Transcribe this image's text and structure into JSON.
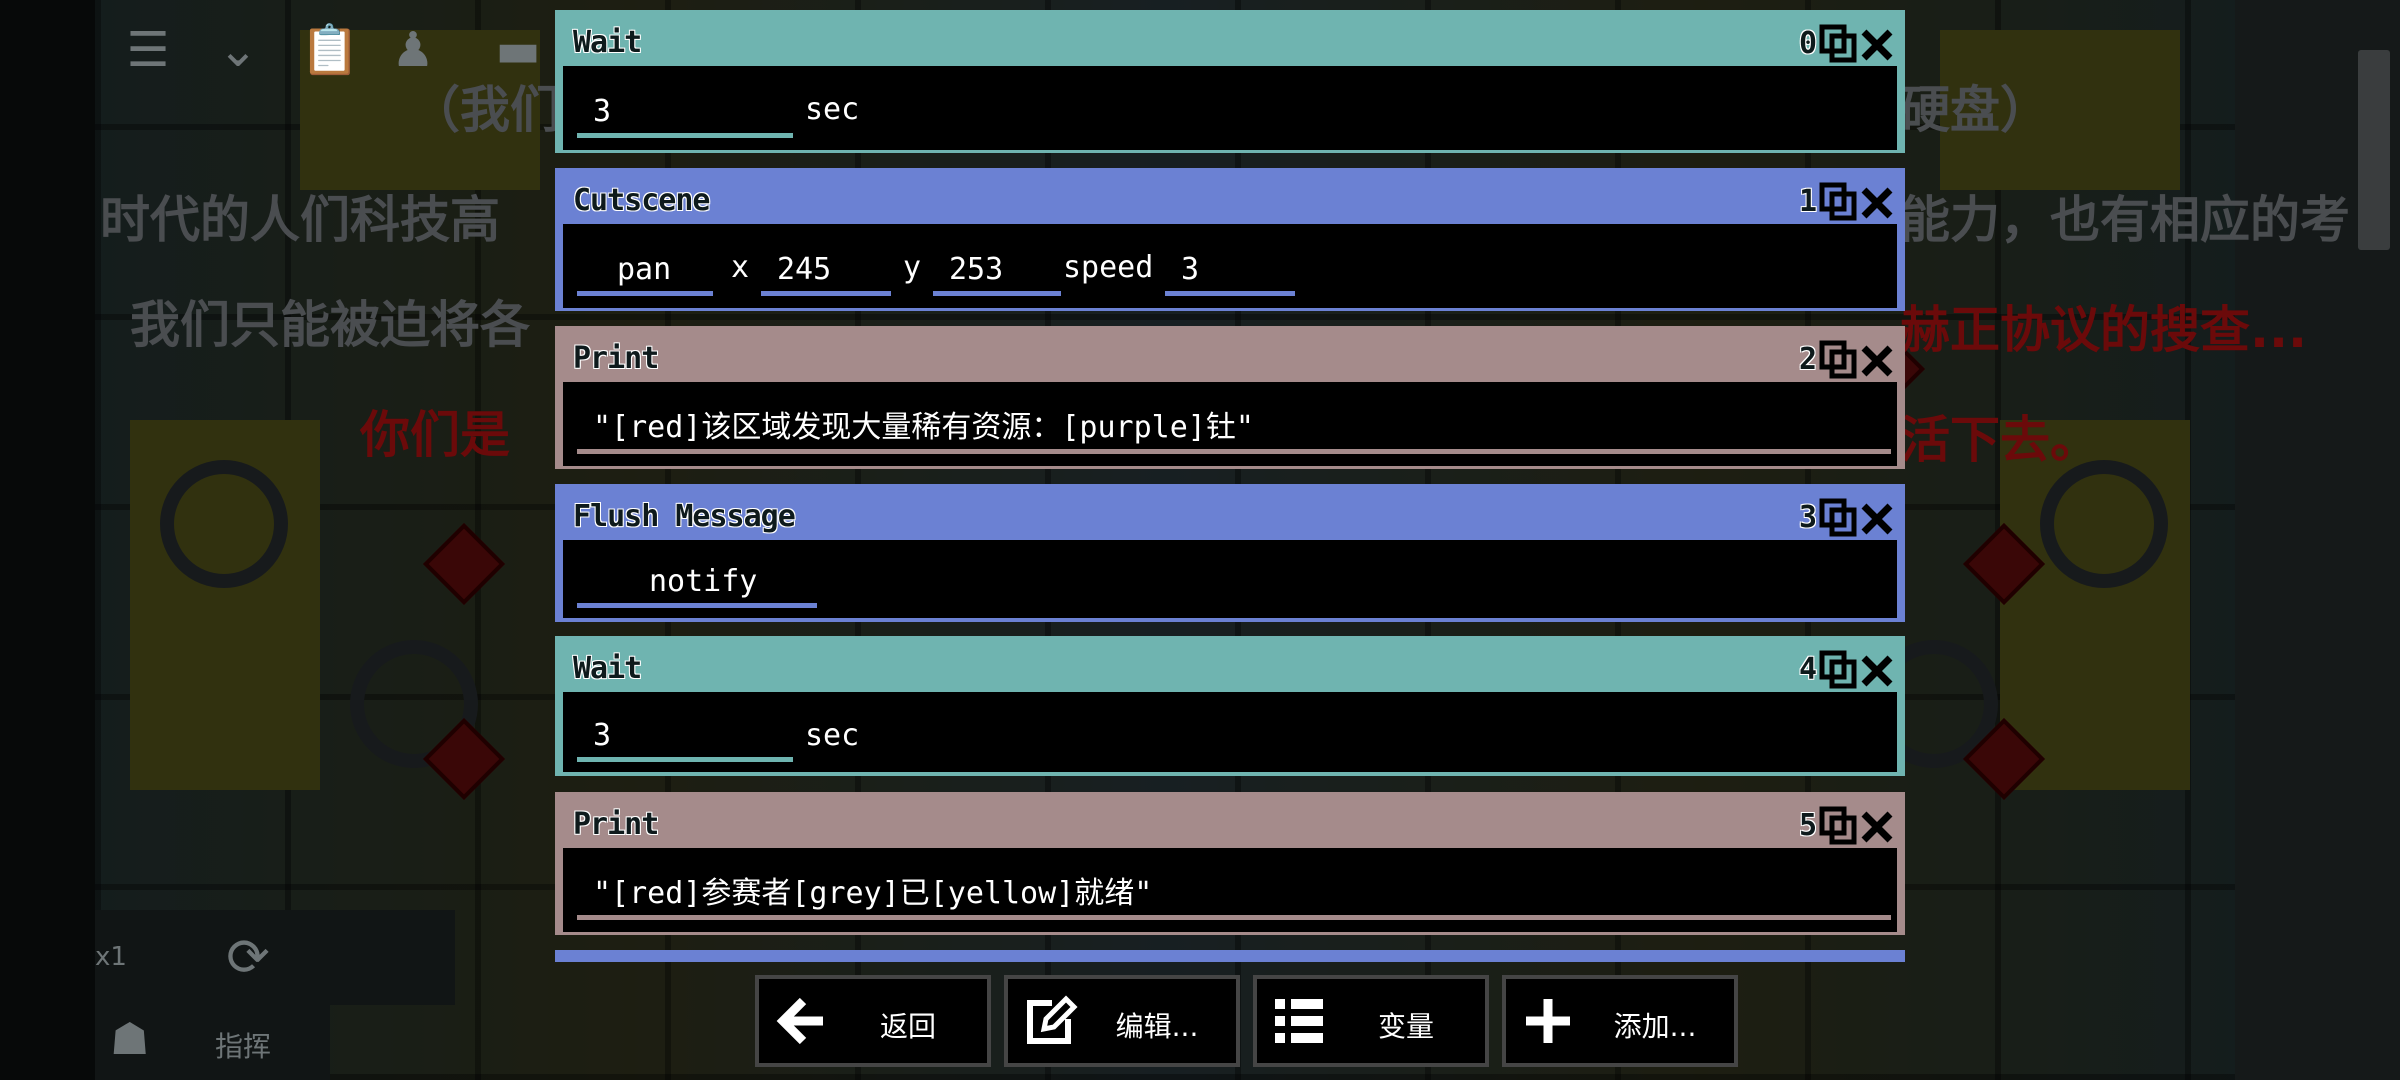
{
  "background": {
    "subtitle_lines": [
      "（我们",
      "硬盘）",
      "时代的人们科技高",
      "能力，也有相应的考",
      "我们只能被迫将各",
      "赫正协议的搜查...",
      "你们是",
      "活下去。"
    ],
    "speed_label": "x1",
    "command_label": "指挥"
  },
  "events": [
    {
      "type": "Wait",
      "index": "0",
      "style": "wait",
      "fields": [
        {
          "value": "3"
        }
      ],
      "unit": "sec"
    },
    {
      "type": "Cutscene",
      "index": "1",
      "style": "cut",
      "mode": "pan",
      "x_label": "x",
      "x": "245",
      "y_label": "y",
      "y": "253",
      "speed_label": "speed",
      "speed": "3"
    },
    {
      "type": "Print",
      "index": "2",
      "style": "prt",
      "text": "\"[red]该区域发现大量稀有资源：[purple]钍\""
    },
    {
      "type": "Flush Message",
      "index": "3",
      "style": "cut",
      "value": "notify"
    },
    {
      "type": "Wait",
      "index": "4",
      "style": "wait",
      "fields": [
        {
          "value": "3"
        }
      ],
      "unit": "sec"
    },
    {
      "type": "Print",
      "index": "5",
      "style": "prt",
      "text": "\"[red]参赛者[grey]已[yellow]就绪\""
    }
  ],
  "buttons": {
    "back": "返回",
    "edit": "编辑...",
    "variables": "变量",
    "add": "添加..."
  },
  "colors": {
    "wait": "#6fb4b0",
    "cutscene": "#6b81d3",
    "print": "#a58b8b",
    "button_border": "#454545"
  },
  "icons": {
    "copy": "copy-icon",
    "close": "close-icon",
    "back": "arrow-left-icon",
    "edit": "edit-icon",
    "variables": "list-icon",
    "add": "plus-icon",
    "refresh": "refresh-icon",
    "command": "unit-icon"
  }
}
